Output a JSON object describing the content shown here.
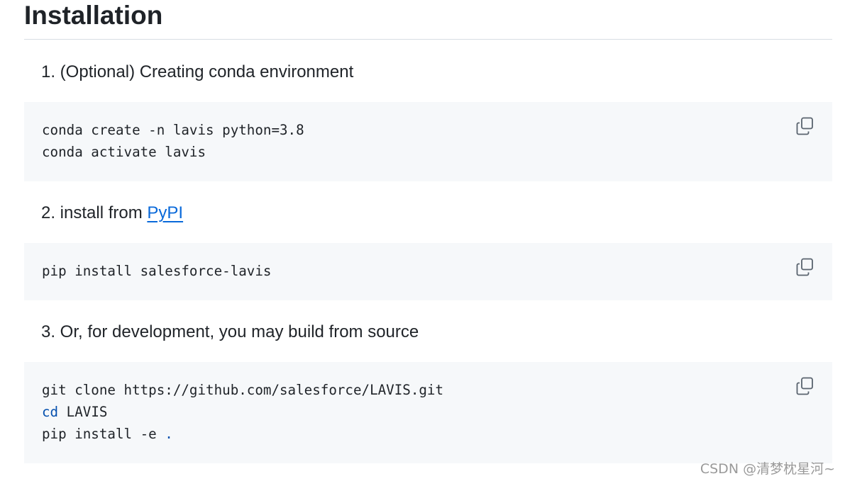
{
  "heading": "Installation",
  "steps": [
    {
      "label": "1. (Optional) Creating conda environment",
      "code": [
        "conda create -n lavis python=3.8",
        "conda activate lavis"
      ]
    },
    {
      "label_prefix": "2. install from ",
      "link_text": "PyPI",
      "code": [
        "pip install salesforce-lavis"
      ]
    },
    {
      "label": "3. Or, for development, you may build from source",
      "code": {
        "line1": "git clone https://github.com/salesforce/LAVIS.git",
        "line2_keyword": "cd",
        "line2_rest": " LAVIS",
        "line3_prefix": "pip install -e ",
        "line3_dot": "."
      }
    }
  ],
  "copy_icon": "copy-icon",
  "watermark": "CSDN @清梦枕星河~",
  "colors": {
    "link": "#0969da",
    "keyword": "#0550ae",
    "code_bg": "#f6f8fa",
    "text": "#1f2328"
  }
}
